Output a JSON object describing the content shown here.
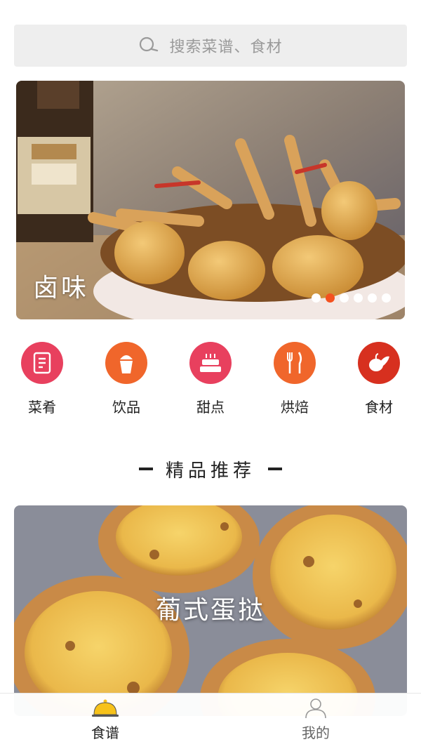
{
  "search": {
    "placeholder": "搜索菜谱、食材",
    "icon": "search-icon"
  },
  "banner": {
    "caption": "卤味",
    "slide_count": 6,
    "active_slide": 2,
    "colors": {
      "dot_active": "#f4511e",
      "dot_inactive": "#ffffff"
    }
  },
  "categories": [
    {
      "label": "菜肴",
      "icon": "recipe-book-icon",
      "color": "#e8405e"
    },
    {
      "label": "饮品",
      "icon": "drink-cup-icon",
      "color": "#f0662b"
    },
    {
      "label": "甜点",
      "icon": "cake-icon",
      "color": "#e8405e"
    },
    {
      "label": "烘焙",
      "icon": "fork-knife-icon",
      "color": "#f0662b"
    },
    {
      "label": "食材",
      "icon": "vegetable-icon",
      "color": "#d7301f"
    }
  ],
  "section": {
    "title": "精品推荐"
  },
  "feature": {
    "caption": "葡式蛋挞"
  },
  "tabbar": {
    "tabs": [
      {
        "label": "食谱",
        "icon": "cloche-icon",
        "active": true,
        "color": "#f7c21a"
      },
      {
        "label": "我的",
        "icon": "user-icon",
        "active": false,
        "color": "#999999"
      }
    ]
  }
}
